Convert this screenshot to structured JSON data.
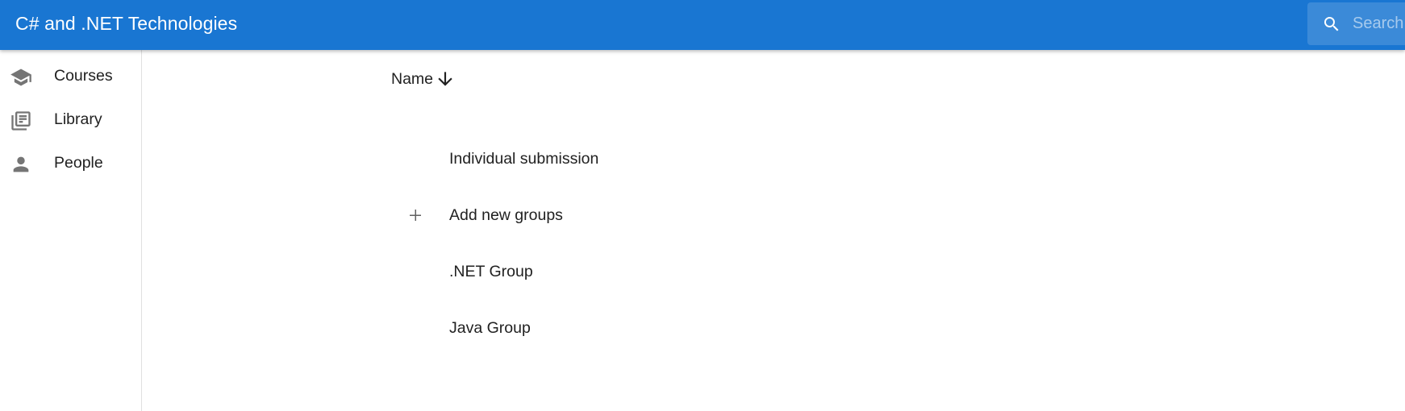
{
  "header": {
    "title": "C# and .NET Technologies",
    "search_placeholder": "Search...",
    "search_icon": "magnify-icon",
    "background_color": "#1976d2"
  },
  "sidebar": {
    "items": [
      {
        "label": "Courses",
        "icon": "school-icon"
      },
      {
        "label": "Library",
        "icon": "library-books-icon"
      },
      {
        "label": "People",
        "icon": "person-icon"
      }
    ]
  },
  "main": {
    "sort_column": "Name",
    "sort_direction": "descending",
    "sort_icon": "arrow-down-icon",
    "rows": [
      {
        "label": "Individual submission"
      },
      {
        "label": "Add new groups",
        "icon": "plus-icon"
      },
      {
        "label": ".NET Group"
      },
      {
        "label": "Java Group"
      }
    ]
  }
}
